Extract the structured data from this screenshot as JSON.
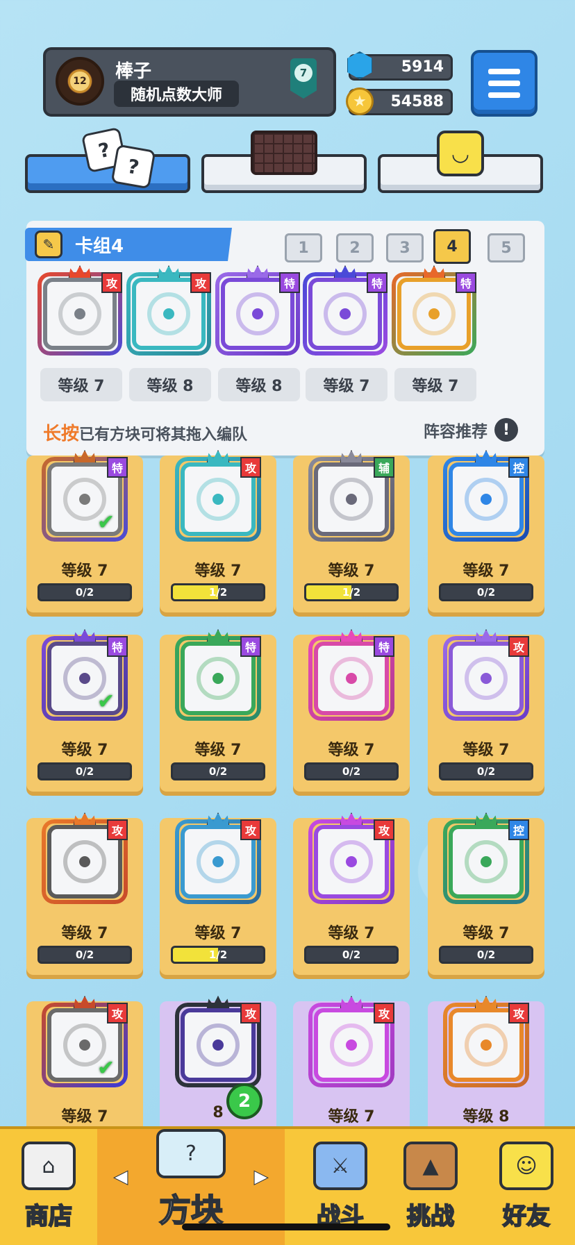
{
  "profile": {
    "name": "棒子",
    "title": "随机点数大师",
    "avatar_level": "12",
    "rank": "7"
  },
  "currency": {
    "gems": "5914",
    "coins": "54588"
  },
  "deck": {
    "title": "卡组4",
    "tabs": [
      "1",
      "2",
      "3",
      "4",
      "5"
    ],
    "active_tab": "4",
    "cards": [
      {
        "tag": "攻",
        "level": "等级 7",
        "icon": "saw-blade-icon",
        "color": "#7a8088",
        "c1": "#e8482a",
        "c2": "#4a4ad8"
      },
      {
        "tag": "攻",
        "level": "等级 8",
        "icon": "splash-icon",
        "color": "#3ab8c0",
        "c1": "#3ab8c0",
        "c2": "#2a8a9a"
      },
      {
        "tag": "特",
        "level": "等级 8",
        "icon": "lightning-icon",
        "color": "#7a4ad8",
        "c1": "#9a6ae8",
        "c2": "#6a3ac8"
      },
      {
        "tag": "特",
        "level": "等级 7",
        "icon": "spiral-icon",
        "color": "#7a4ad8",
        "c1": "#4a4ad8",
        "c2": "#9a4ae0"
      },
      {
        "tag": "特",
        "level": "等级 7",
        "icon": "infinity-icon",
        "color": "#e8a02a",
        "c1": "#e8682a",
        "c2": "#3aa85a"
      }
    ],
    "hint_emph": "长按",
    "hint_rest": "已有方块可将其拖入编队",
    "recommend": "阵容推荐"
  },
  "collection": [
    {
      "tag": "特",
      "level": "等级 7",
      "progress": "0/2",
      "fill": 0,
      "checked": true,
      "color": "#7a7a7a",
      "c1": "#c8682a",
      "c2": "#4a4ad8",
      "purple": false
    },
    {
      "tag": "攻",
      "level": "等级 7",
      "progress": "1/2",
      "fill": 0.5,
      "checked": false,
      "color": "#3ab8c0",
      "c1": "#3ab8c0",
      "c2": "#2a7aa0",
      "purple": false
    },
    {
      "tag": "辅",
      "level": "等级 7",
      "progress": "1/2",
      "fill": 0.5,
      "checked": false,
      "color": "#6a6a7a",
      "c1": "#8a8a9a",
      "c2": "#5a5a6a",
      "purple": false
    },
    {
      "tag": "控",
      "level": "等级 7",
      "progress": "0/2",
      "fill": 0,
      "checked": false,
      "color": "#2f86e6",
      "c1": "#2f86e6",
      "c2": "#1a4ab0",
      "purple": false
    },
    {
      "tag": "特",
      "level": "等级 7",
      "progress": "0/2",
      "fill": 0,
      "checked": true,
      "color": "#5a4a8a",
      "c1": "#7a4ad8",
      "c2": "#4a3a9a",
      "purple": false
    },
    {
      "tag": "特",
      "level": "等级 7",
      "progress": "0/2",
      "fill": 0,
      "checked": false,
      "color": "#3aa85a",
      "c1": "#3aa85a",
      "c2": "#2a8a6a",
      "purple": false
    },
    {
      "tag": "特",
      "level": "等级 7",
      "progress": "0/2",
      "fill": 0,
      "checked": false,
      "color": "#d84aa8",
      "c1": "#e84ab8",
      "c2": "#b03a90",
      "purple": false
    },
    {
      "tag": "攻",
      "level": "等级 7",
      "progress": "0/2",
      "fill": 0,
      "checked": false,
      "color": "#8a5ad8",
      "c1": "#9a6ae8",
      "c2": "#6a3ac8",
      "purple": false
    },
    {
      "tag": "攻",
      "level": "等级 7",
      "progress": "0/2",
      "fill": 0,
      "checked": false,
      "color": "#5a5a5a",
      "c1": "#e8782a",
      "c2": "#c84a2a",
      "purple": false
    },
    {
      "tag": "攻",
      "level": "等级 7",
      "progress": "1/2",
      "fill": 0.5,
      "checked": false,
      "color": "#3a9ad0",
      "c1": "#3a9ad0",
      "c2": "#2a6a9a",
      "purple": false
    },
    {
      "tag": "攻",
      "level": "等级 7",
      "progress": "0/2",
      "fill": 0,
      "checked": false,
      "color": "#9a4ae0",
      "c1": "#c84ae0",
      "c2": "#7a3ac8",
      "purple": false
    },
    {
      "tag": "控",
      "level": "等级 7",
      "progress": "0/2",
      "fill": 0,
      "checked": false,
      "color": "#3aa85a",
      "c1": "#3aa85a",
      "c2": "#2a7a8a",
      "purple": false
    },
    {
      "tag": "攻",
      "level": "等级 7",
      "progress": "",
      "fill": 0,
      "checked": true,
      "color": "#6a6a6a",
      "c1": "#c84a2a",
      "c2": "#3a3ad8",
      "purple": false
    },
    {
      "tag": "攻",
      "level": "8",
      "progress": "",
      "fill": 0,
      "checked": false,
      "color": "#4a3a9a",
      "c1": "#2c323a",
      "c2": "#2c323a",
      "purple": true
    },
    {
      "tag": "攻",
      "level": "等级 7",
      "progress": "",
      "fill": 0,
      "checked": false,
      "color": "#c84ae0",
      "c1": "#c84ae0",
      "c2": "#a03ac0",
      "purple": true
    },
    {
      "tag": "攻",
      "level": "等级 8",
      "progress": "",
      "fill": 0,
      "checked": false,
      "color": "#e8882a",
      "c1": "#e8882a",
      "c2": "#c8682a",
      "purple": true
    }
  ],
  "nav": {
    "shop": "商店",
    "blocks": "方块",
    "battle": "战斗",
    "challenge": "挑战",
    "friends": "好友",
    "badge_count": "2"
  }
}
